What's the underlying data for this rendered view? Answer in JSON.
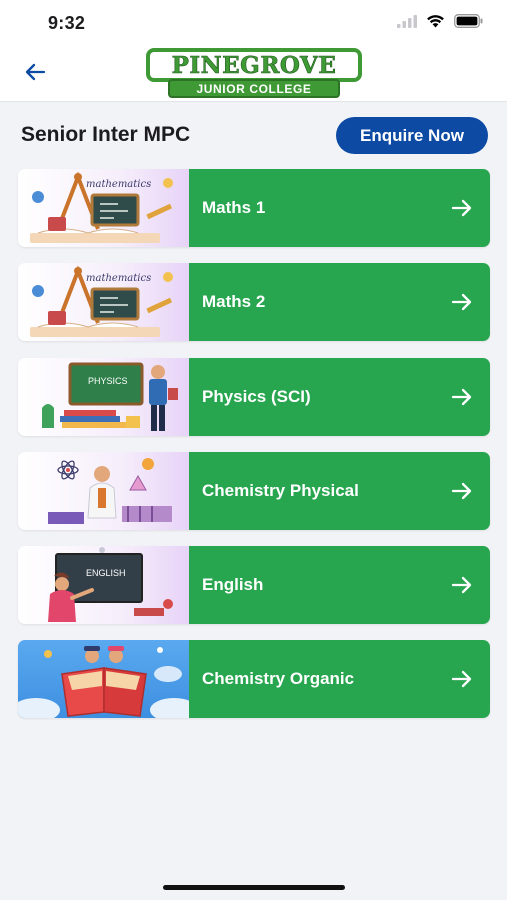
{
  "status_bar": {
    "time": "9:32"
  },
  "header": {
    "logo_name": "PINEGROVE",
    "logo_subtitle": "JUNIOR COLLEGE"
  },
  "page": {
    "title": "Senior Inter MPC",
    "enquire_label": "Enquire Now"
  },
  "courses": [
    {
      "label": "Maths 1",
      "thumbnail": "mathematics-illustration"
    },
    {
      "label": "Maths 2",
      "thumbnail": "mathematics-illustration"
    },
    {
      "label": "Physics (SCI)",
      "thumbnail": "physics-illustration"
    },
    {
      "label": "Chemistry Physical",
      "thumbnail": "chemistry-illustration"
    },
    {
      "label": "English",
      "thumbnail": "english-illustration"
    },
    {
      "label": "Chemistry Organic",
      "thumbnail": "reading-book-illustration"
    }
  ],
  "thumbnail_text": {
    "mathematics": "mathematics",
    "physics": "PHYSICS",
    "english": "ENGLISH"
  },
  "colors": {
    "card_green": "#27a64f",
    "enquire_blue": "#0d4aa3",
    "logo_green": "#3f9a36",
    "back_arrow": "#0d4aa3"
  }
}
